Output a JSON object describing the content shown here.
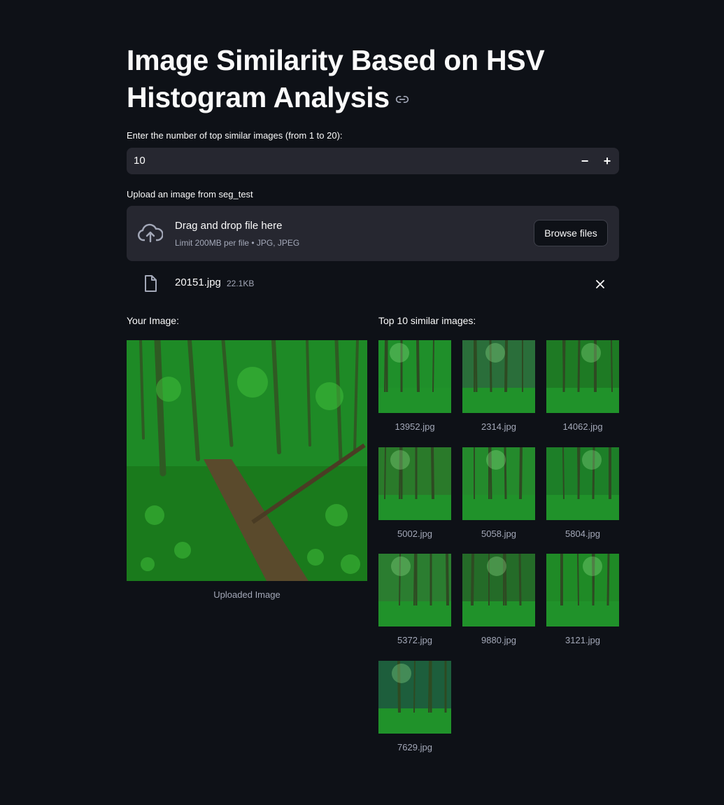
{
  "header": {
    "title": "Image Similarity Based on HSV Histogram Analysis"
  },
  "number_input": {
    "label": "Enter the number of top similar images (from 1 to 20):",
    "value": "10",
    "decrement": "−",
    "increment": "+"
  },
  "uploader": {
    "label": "Upload an image from seg_test",
    "title": "Drag and drop file here",
    "subtitle": "Limit 200MB per file • JPG, JPEG",
    "browse_label": "Browse files",
    "file": {
      "name": "20151.jpg",
      "size": "22.1KB"
    }
  },
  "your_image": {
    "heading": "Your Image:",
    "caption": "Uploaded Image"
  },
  "results": {
    "heading": "Top 10 similar images:",
    "items": [
      {
        "caption": "13952.jpg"
      },
      {
        "caption": "2314.jpg"
      },
      {
        "caption": "14062.jpg"
      },
      {
        "caption": "5002.jpg"
      },
      {
        "caption": "5058.jpg"
      },
      {
        "caption": "5804.jpg"
      },
      {
        "caption": "5372.jpg"
      },
      {
        "caption": "9880.jpg"
      },
      {
        "caption": "3121.jpg"
      },
      {
        "caption": "7629.jpg"
      }
    ]
  },
  "colors": {
    "background": "#0e1117",
    "widget_bg": "#262730",
    "text": "#fafafa",
    "muted": "#a3a8b8",
    "forest_green": "#1f8a1f"
  }
}
